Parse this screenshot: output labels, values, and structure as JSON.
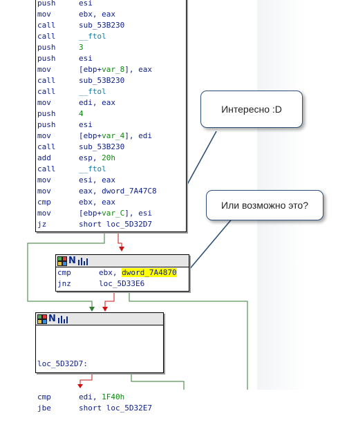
{
  "main_block": {
    "lines": [
      {
        "mn": "push",
        "op": [
          {
            "t": "esi",
            "c": "kw"
          }
        ]
      },
      {
        "mn": "mov",
        "op": [
          {
            "t": "ebx, eax",
            "c": "kw"
          }
        ]
      },
      {
        "mn": "call",
        "op": [
          {
            "t": "sub_53B230",
            "c": "kw"
          }
        ]
      },
      {
        "mn": "call",
        "op": [
          {
            "t": "__ftol",
            "c": "fn"
          }
        ]
      },
      {
        "mn": "push",
        "op": [
          {
            "t": "3",
            "c": "num"
          }
        ]
      },
      {
        "mn": "push",
        "op": [
          {
            "t": "esi",
            "c": "kw"
          }
        ]
      },
      {
        "mn": "mov",
        "op": [
          {
            "t": "[ebp+",
            "c": "kw"
          },
          {
            "t": "var_8",
            "c": "var"
          },
          {
            "t": "], eax",
            "c": "kw"
          }
        ]
      },
      {
        "mn": "call",
        "op": [
          {
            "t": "sub_53B230",
            "c": "kw"
          }
        ]
      },
      {
        "mn": "call",
        "op": [
          {
            "t": "__ftol",
            "c": "fn"
          }
        ]
      },
      {
        "mn": "mov",
        "op": [
          {
            "t": "edi, eax",
            "c": "kw"
          }
        ]
      },
      {
        "mn": "push",
        "op": [
          {
            "t": "4",
            "c": "num"
          }
        ]
      },
      {
        "mn": "push",
        "op": [
          {
            "t": "esi",
            "c": "kw"
          }
        ]
      },
      {
        "mn": "mov",
        "op": [
          {
            "t": "[ebp+",
            "c": "kw"
          },
          {
            "t": "var_4",
            "c": "var"
          },
          {
            "t": "], edi",
            "c": "kw"
          }
        ]
      },
      {
        "mn": "call",
        "op": [
          {
            "t": "sub_53B230",
            "c": "kw"
          }
        ]
      },
      {
        "mn": "add",
        "op": [
          {
            "t": "esp, ",
            "c": "kw"
          },
          {
            "t": "20h",
            "c": "num"
          }
        ]
      },
      {
        "mn": "call",
        "op": [
          {
            "t": "__ftol",
            "c": "fn"
          }
        ]
      },
      {
        "mn": "mov",
        "op": [
          {
            "t": "esi, eax",
            "c": "kw"
          }
        ]
      },
      {
        "mn": "mov",
        "op": [
          {
            "t": "eax, dword_7A47C8",
            "c": "kw"
          }
        ]
      },
      {
        "mn": "cmp",
        "op": [
          {
            "t": "ebx, eax",
            "c": "kw"
          }
        ]
      },
      {
        "mn": "mov",
        "op": [
          {
            "t": "[ebp+",
            "c": "kw"
          },
          {
            "t": "var_C",
            "c": "var"
          },
          {
            "t": "], esi",
            "c": "kw"
          }
        ]
      },
      {
        "mn": "jz",
        "op": [
          {
            "t": "short loc_5D32D7",
            "c": "kw"
          }
        ]
      }
    ]
  },
  "block2": {
    "lines": [
      {
        "mn": "cmp",
        "op": [
          {
            "t": "ebx, ",
            "c": "kw"
          },
          {
            "t": "dword_7A4870",
            "c": "hl"
          }
        ]
      },
      {
        "mn": "jnz",
        "op": [
          {
            "t": "loc_5D33E6",
            "c": "kw"
          }
        ]
      }
    ]
  },
  "block3": {
    "label": "loc_5D32D7:",
    "lines": [
      {
        "mn": "cmp",
        "op": [
          {
            "t": "edi, ",
            "c": "kw"
          },
          {
            "t": "1F40h",
            "c": "num"
          }
        ]
      },
      {
        "mn": "jbe",
        "op": [
          {
            "t": "short loc_5D32E7",
            "c": "kw"
          }
        ]
      }
    ]
  },
  "callouts": {
    "first": "Интересно :D",
    "second": "Или возможно это?"
  },
  "colors": {
    "edge_green": "#2f7d2f",
    "edge_red": "#cc1111",
    "bubble_border": "#2d4f78",
    "highlight": "#ffff00"
  }
}
